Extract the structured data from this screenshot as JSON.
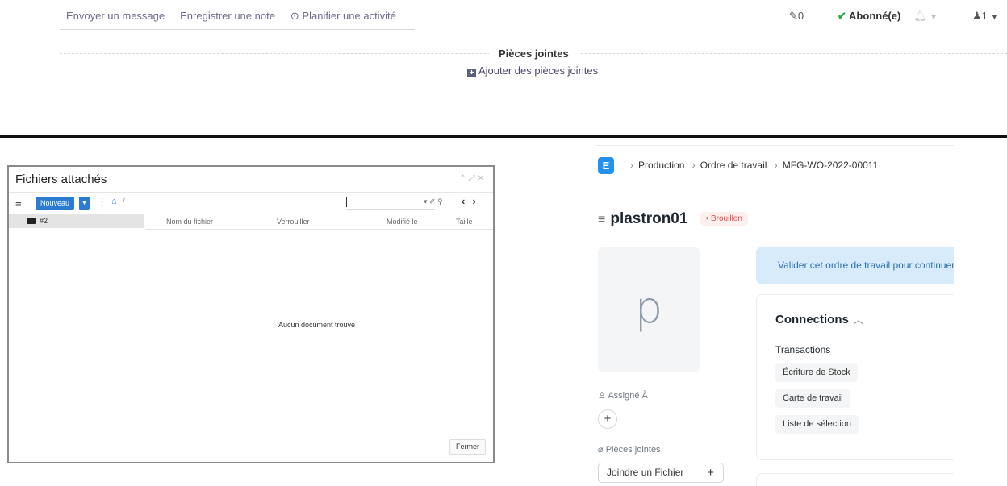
{
  "chatter": {
    "send_message": "Envoyer un message",
    "log_note": "Enregistrer une note",
    "schedule_activity": "Planifier une activité",
    "attachments_count": "0",
    "following_label": "Abonné(e)",
    "followers_count": "1",
    "attachments_title": "Pièces jointes",
    "add_attachments": "Ajouter des pièces jointes"
  },
  "dialog": {
    "title": "Fichiers attachés",
    "new_button": "Nouveau",
    "path_separator": "/",
    "tree_folder": "#2",
    "columns": [
      "Nom du fichier",
      "Verrouiller",
      "Modifié le",
      "Taille"
    ],
    "empty_message": "Aucun document trouvé",
    "close_button": "Fermer"
  },
  "erp": {
    "logo_letter": "E",
    "breadcrumb": [
      "Production",
      "Ordre de travail",
      "MFG-WO-2022-00011"
    ],
    "title": "plastron01",
    "status": "Brouillon",
    "avatar_letter": "p",
    "assigned_to": "Assigné À",
    "attachments_label": "Pièces jointes",
    "attach_file": "Joindre un Fichier",
    "alert": "Valider cet ordre de travail pour continuer",
    "connections_title": "Connections",
    "transactions_label": "Transactions",
    "transactions": [
      "Écriture de Stock",
      "Carte de travail",
      "Liste de sélection"
    ]
  },
  "colors": {
    "erp_primary": "#2490ef",
    "draft_red": "#e24c4c",
    "dialog_button_blue": "#2b7bd3",
    "follow_green": "#28a745"
  }
}
